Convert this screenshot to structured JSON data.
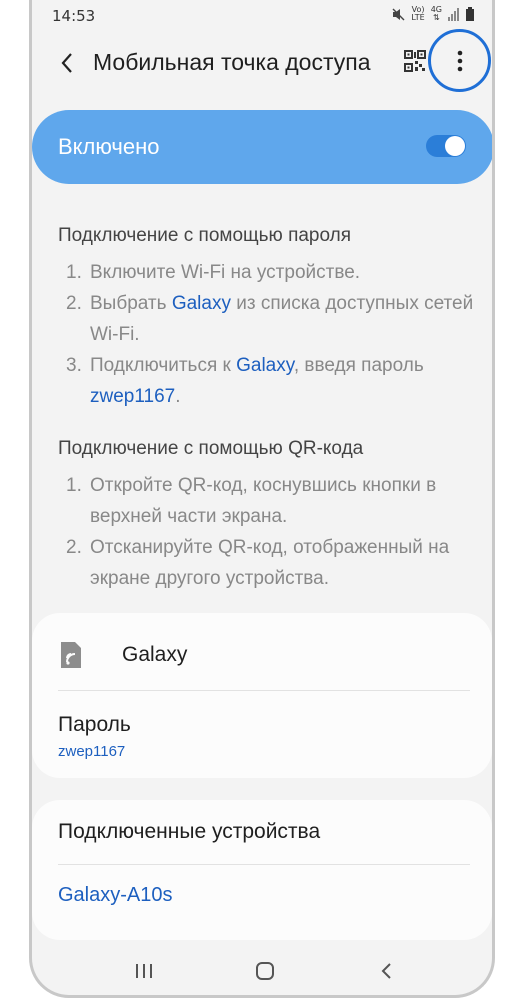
{
  "status": {
    "time": "14:53",
    "volte": "Vo)",
    "lte": "LTE",
    "net": "4G"
  },
  "appbar": {
    "title": "Мобильная точка доступа",
    "icons": [
      "back-icon",
      "qr-code-icon",
      "more-options-icon"
    ],
    "highlight_color": "#1f6fd6"
  },
  "toggle": {
    "label": "Включено",
    "on": true,
    "bar_color": "#5fa7ec",
    "switch_color": "#2b7ed8"
  },
  "password_section": {
    "heading": "Подключение с помощью пароля",
    "step1": {
      "num": "1.",
      "text": "Включите Wi-Fi на устройстве."
    },
    "step2": {
      "num": "2.",
      "pre": "Выбрать ",
      "link": "Galaxy",
      "post": " из списка доступных сетей Wi-Fi."
    },
    "step3": {
      "num": "3.",
      "pre": "Подключиться к ",
      "link": "Galaxy",
      "mid": ", введя пароль ",
      "link2": "zwep1167",
      "post": "."
    }
  },
  "qr_section": {
    "heading": "Подключение с помощью QR-кода",
    "step1": {
      "num": "1.",
      "text": "Откройте QR-код, коснувшись кнопки в верхней части экрана."
    },
    "step2": {
      "num": "2.",
      "text": "Отсканируйте QR-код, отображенный на экране другого устройства."
    }
  },
  "network_card": {
    "network_name": "Galaxy",
    "password_label": "Пароль",
    "password_value": "zwep1167"
  },
  "connected_card": {
    "heading": "Подключенные устройства",
    "device": "Galaxy-A10s"
  },
  "navbar": {
    "icons": [
      "recent-apps-icon",
      "home-icon",
      "back-nav-icon"
    ]
  },
  "colors": {
    "accent": "#1d5fbf",
    "background": "#f3f3f3"
  }
}
